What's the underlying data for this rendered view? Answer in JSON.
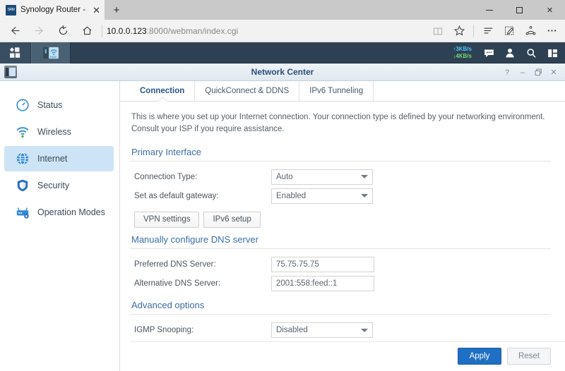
{
  "browser": {
    "tab": {
      "title": "Synology Router - Syno",
      "favicon_label": "SRM",
      "close_label": "✕"
    },
    "new_tab_label": "+",
    "window_controls": {
      "minimize": "–",
      "maximize": "□",
      "close": "✕"
    },
    "nav": {
      "back": "back-arrow",
      "forward": "forward-arrow",
      "refresh": "refresh-arrow",
      "home": "home-icon"
    },
    "address": {
      "host": "10.0.0.123",
      "path": ":8000/webman/index.cgi",
      "full": "10.0.0.123:8000/webman/index.cgi"
    },
    "toolbar_icons": [
      "reading-view-icon",
      "favorites-star-icon",
      "hub-icon",
      "web-note-icon",
      "share-icon",
      "more-icon"
    ]
  },
  "dsm_taskbar": {
    "main_menu": "main-menu-icon",
    "tasks": [
      {
        "name": "network-center-task",
        "icon": "router-icon"
      }
    ],
    "network_speed": {
      "upload": "3KB/s",
      "download": "4KB/s",
      "upload_arrow": "↑",
      "download_arrow": "↓",
      "upload_color": "#4fc3f7",
      "download_color": "#76d275"
    },
    "system_icons": [
      "notifications-icon",
      "user-icon",
      "search-icon",
      "widgets-icon"
    ]
  },
  "window": {
    "title": "Network Center",
    "app_icon": "router-icon",
    "controls": {
      "help": "?",
      "minimize": "–",
      "maximize": "❐",
      "close": "✕"
    }
  },
  "sidebar": {
    "items": [
      {
        "label": "Status",
        "icon": "status-gauge-icon",
        "active": false
      },
      {
        "label": "Wireless",
        "icon": "wifi-icon",
        "active": false
      },
      {
        "label": "Internet",
        "icon": "globe-icon",
        "active": true
      },
      {
        "label": "Security",
        "icon": "shield-icon",
        "active": false
      },
      {
        "label": "Operation Modes",
        "icon": "operation-modes-icon",
        "active": false
      }
    ]
  },
  "tabs": [
    {
      "label": "Connection",
      "active": true
    },
    {
      "label": "QuickConnect & DDNS",
      "active": false
    },
    {
      "label": "IPv6 Tunneling",
      "active": false
    }
  ],
  "main": {
    "intro": "This is where you set up your Internet connection. Your connection type is defined by your networking environment. Consult your ISP if you require assistance.",
    "sections": [
      {
        "title": "Primary Interface",
        "fields": [
          {
            "label": "Connection Type:",
            "type": "select",
            "value": "Auto"
          },
          {
            "label": "Set as default gateway:",
            "type": "select",
            "value": "Enabled"
          }
        ],
        "buttons": [
          {
            "label": "VPN settings"
          },
          {
            "label": "IPv6 setup"
          }
        ]
      },
      {
        "title": "Manually configure DNS server",
        "fields": [
          {
            "label": "Preferred DNS Server:",
            "type": "input",
            "value": "75.75.75.75"
          },
          {
            "label": "Alternative DNS Server:",
            "type": "input",
            "value": "2001:558:feed::1"
          }
        ]
      },
      {
        "title": "Advanced options",
        "fields": [
          {
            "label": "IGMP Snooping:",
            "type": "select",
            "value": "Disabled"
          }
        ]
      }
    ]
  },
  "footer": {
    "apply_label": "Apply",
    "reset_label": "Reset",
    "apply_color": "#1f6fc4"
  }
}
